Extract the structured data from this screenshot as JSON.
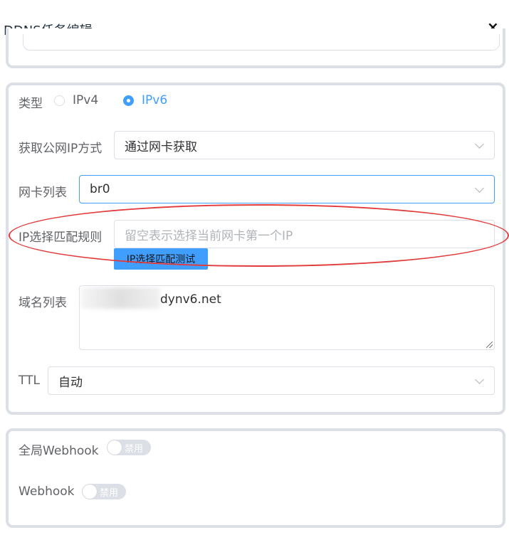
{
  "dialog": {
    "title": "DDNS任务编辑",
    "close_glyph": "×"
  },
  "form": {
    "type_label": "类型",
    "type_options": [
      {
        "label": "IPv4",
        "checked": false
      },
      {
        "label": "IPv6",
        "checked": true
      }
    ],
    "ip_method_label": "获取公网IP方式",
    "ip_method_value": "通过网卡获取",
    "nic_list_label": "网卡列表",
    "nic_list_value": "br0",
    "ip_rule_label": "IP选择匹配规则",
    "ip_rule_placeholder": "留空表示选择当前网卡第一个IP",
    "ip_rule_test_button": "IP选择匹配测试",
    "domain_list_label": "域名列表",
    "domain_list_value": "dynv6.net",
    "ttl_label": "TTL",
    "ttl_value": "自动"
  },
  "webhook": {
    "global_label": "全局Webhook",
    "global_switch_text": "禁用",
    "webhook_label": "Webhook",
    "webhook_switch_text": "禁用"
  },
  "colors": {
    "accent": "#409eff",
    "annotation": "#e23b3b",
    "border": "#dcdfe6"
  }
}
